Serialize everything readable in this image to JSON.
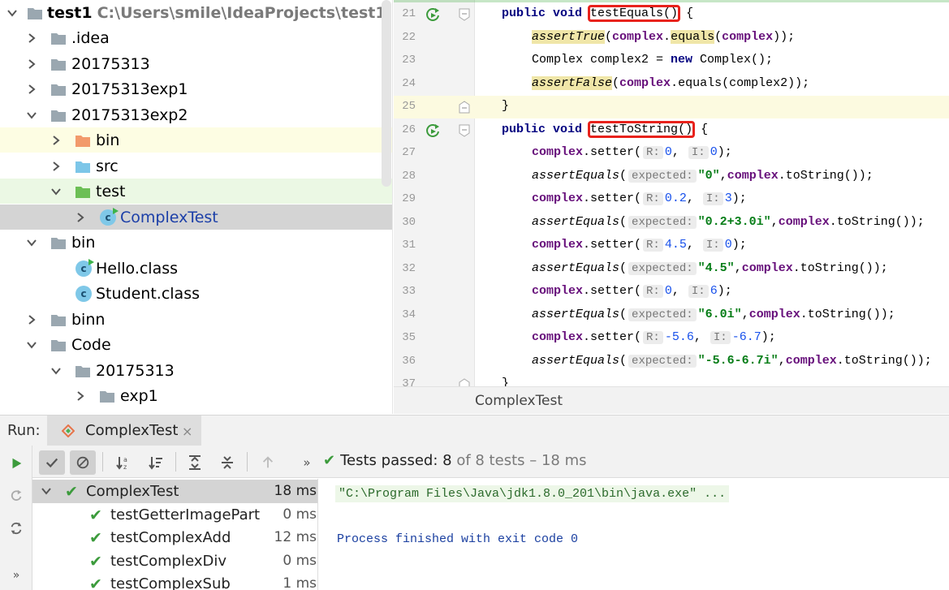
{
  "project": {
    "root": {
      "name": "test1",
      "path": "C:\\Users\\smile\\IdeaProjects\\test1"
    },
    "items": [
      {
        "label": ".idea"
      },
      {
        "label": "20175313"
      },
      {
        "label": "20175313exp1"
      },
      {
        "label": "20175313exp2"
      },
      {
        "label": "bin"
      },
      {
        "label": "src"
      },
      {
        "label": "test"
      },
      {
        "label": "ComplexTest"
      },
      {
        "label": "bin"
      },
      {
        "label": "Hello.class"
      },
      {
        "label": "Student.class"
      },
      {
        "label": "binn"
      },
      {
        "label": "Code"
      },
      {
        "label": "20175313"
      },
      {
        "label": "exp1"
      }
    ]
  },
  "editor": {
    "line_numbers": [
      "21",
      "22",
      "23",
      "24",
      "25",
      "26",
      "27",
      "28",
      "29",
      "30",
      "31",
      "32",
      "33",
      "34",
      "35",
      "36",
      "37"
    ],
    "tab_label": "ComplexTest",
    "code": {
      "l21": {
        "kw": "public void ",
        "name": "testEquals",
        "parens": "()",
        "rest": " {"
      },
      "l22": {
        "fn": "assertTrue",
        "p1": "(",
        "obj": "complex",
        "dot": ".",
        "method": "equals",
        "p2": "(",
        "arg": "complex",
        "p3": "));"
      },
      "l23": {
        "a": "Complex complex2 = ",
        "kw": "new",
        "b": " Complex();"
      },
      "l24": {
        "fn": "assertFalse",
        "p1": "(",
        "obj": "complex",
        "rest": ".equals(complex2));"
      },
      "l25": {
        "text": "}"
      },
      "l26": {
        "kw": "public void ",
        "name": "testToString",
        "parens": "()",
        "rest": " {"
      },
      "setter_lines": [
        {
          "r": "0",
          "i": "0"
        },
        {
          "r": "0.2",
          "i": "3"
        },
        {
          "r": "4.5",
          "i": "0"
        },
        {
          "r": "0",
          "i": "6"
        },
        {
          "r": "-5.6",
          "i": "-6.7"
        }
      ],
      "assert_lines": [
        {
          "expected": "\"0\""
        },
        {
          "expected": "\"0.2+3.0i\""
        },
        {
          "expected": "\"4.5\""
        },
        {
          "expected": "\"6.0i\""
        },
        {
          "expected": "\"-5.6-6.7i\""
        }
      ],
      "tokens": {
        "obj": "complex",
        "setter": ".setter(",
        "r_hint": "R:",
        "i_hint": "I:",
        "comma": ", ",
        "close": ");",
        "assert_fn": "assertEquals",
        "open": "(",
        "expected_hint": "expected:",
        "tostring": ".toString());"
      },
      "l37": {
        "text": "}"
      }
    }
  },
  "run": {
    "label": "Run:",
    "tab_label": "ComplexTest",
    "tab_close": "×",
    "status": {
      "prefix": "Tests passed: ",
      "count": "8",
      "suffix": " of 8 tests – 18 ms"
    },
    "tests": [
      {
        "name": "ComplexTest",
        "time": "18 ms"
      },
      {
        "name": "testGetterImagePart",
        "time": "0 ms"
      },
      {
        "name": "testComplexAdd",
        "time": "12 ms"
      },
      {
        "name": "testComplexDiv",
        "time": "0 ms"
      },
      {
        "name": "testComplexSub",
        "time": "1 ms"
      }
    ],
    "console": {
      "line1": "\"C:\\Program Files\\Java\\jdk1.8.0_201\\bin\\java.exe\" ...",
      "line2": "Process finished with exit code 0"
    }
  },
  "colors": {
    "keyword": "#000080",
    "field": "#660e7a",
    "string": "#067d17",
    "number": "#1750eb",
    "highlight_box": "#e8221c",
    "pass": "#3c9b3c"
  }
}
